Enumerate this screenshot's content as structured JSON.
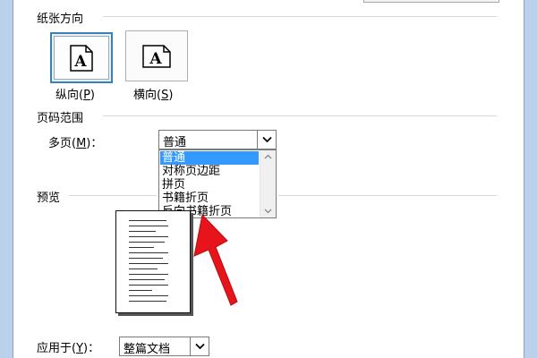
{
  "orientation": {
    "title": "纸张方向",
    "portrait": {
      "label": "纵向(",
      "key": "P",
      "end": ")",
      "glyph": "A"
    },
    "landscape": {
      "label": "横向(",
      "key": "S",
      "end": ")",
      "glyph": "A"
    }
  },
  "pages": {
    "title": "页码范围",
    "multiple_label": "多页(",
    "multiple_key": "M",
    "multiple_end": ")：",
    "selected": "普通",
    "options": [
      "普通",
      "对称页边距",
      "拼页",
      "书籍折页",
      "反向书籍折页"
    ]
  },
  "preview": {
    "title": "预览",
    "apply_label": "应用于(",
    "apply_key": "Y",
    "apply_end": ")：",
    "apply_value": "整篇文档"
  },
  "colors": {
    "highlight": "#3399ff",
    "selected_border": "#3c7fb1",
    "annotation_arrow": "#e8141b"
  }
}
